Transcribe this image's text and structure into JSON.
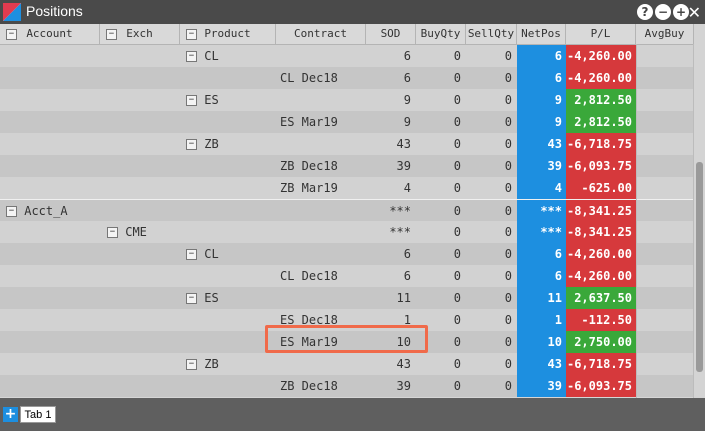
{
  "window": {
    "title": "Positions"
  },
  "columns": {
    "account": "Account",
    "exch": "Exch",
    "product": "Product",
    "contract": "Contract",
    "sod": "SOD",
    "buyqty": "BuyQty",
    "sellqty": "SellQty",
    "netpos": "NetPos",
    "pl": "P/L",
    "avgbuy": "AvgBuy"
  },
  "rows": [
    {
      "product": "CL",
      "contract": "",
      "sod": "6",
      "buy": "0",
      "sell": "0",
      "net": "6",
      "pl": "-4,260.00",
      "pl_sign": "neg"
    },
    {
      "product": "",
      "contract": "CL Dec18",
      "sod": "6",
      "buy": "0",
      "sell": "0",
      "net": "6",
      "pl": "-4,260.00",
      "pl_sign": "neg"
    },
    {
      "product": "ES",
      "contract": "",
      "sod": "9",
      "buy": "0",
      "sell": "0",
      "net": "9",
      "pl": "2,812.50",
      "pl_sign": "pos"
    },
    {
      "product": "",
      "contract": "ES Mar19",
      "sod": "9",
      "buy": "0",
      "sell": "0",
      "net": "9",
      "pl": "2,812.50",
      "pl_sign": "pos"
    },
    {
      "product": "ZB",
      "contract": "",
      "sod": "43",
      "buy": "0",
      "sell": "0",
      "net": "43",
      "pl": "-6,718.75",
      "pl_sign": "neg"
    },
    {
      "product": "",
      "contract": "ZB Dec18",
      "sod": "39",
      "buy": "0",
      "sell": "0",
      "net": "39",
      "pl": "-6,093.75",
      "pl_sign": "neg"
    },
    {
      "product": "",
      "contract": "ZB Mar19",
      "sod": "4",
      "buy": "0",
      "sell": "0",
      "net": "4",
      "pl": "-625.00",
      "pl_sign": "neg"
    },
    {
      "account": "Acct_A",
      "sod": "***",
      "buy": "0",
      "sell": "0",
      "net": "***",
      "pl": "-8,341.25",
      "pl_sign": "neg"
    },
    {
      "exch": "CME",
      "sod": "***",
      "buy": "0",
      "sell": "0",
      "net": "***",
      "pl": "-8,341.25",
      "pl_sign": "neg"
    },
    {
      "product": "CL",
      "contract": "",
      "sod": "6",
      "buy": "0",
      "sell": "0",
      "net": "6",
      "pl": "-4,260.00",
      "pl_sign": "neg"
    },
    {
      "product": "",
      "contract": "CL Dec18",
      "sod": "6",
      "buy": "0",
      "sell": "0",
      "net": "6",
      "pl": "-4,260.00",
      "pl_sign": "neg"
    },
    {
      "product": "ES",
      "contract": "",
      "sod": "11",
      "buy": "0",
      "sell": "0",
      "net": "11",
      "pl": "2,637.50",
      "pl_sign": "pos"
    },
    {
      "product": "",
      "contract": "ES Dec18",
      "sod": "1",
      "buy": "0",
      "sell": "0",
      "net": "1",
      "pl": "-112.50",
      "pl_sign": "neg"
    },
    {
      "product": "",
      "contract": "ES Mar19",
      "sod": "10",
      "buy": "0",
      "sell": "0",
      "net": "10",
      "pl": "2,750.00",
      "pl_sign": "pos"
    },
    {
      "product": "ZB",
      "contract": "",
      "sod": "43",
      "buy": "0",
      "sell": "0",
      "net": "43",
      "pl": "-6,718.75",
      "pl_sign": "neg"
    },
    {
      "product": "",
      "contract": "ZB Dec18",
      "sod": "39",
      "buy": "0",
      "sell": "0",
      "net": "39",
      "pl": "-6,093.75",
      "pl_sign": "neg"
    }
  ],
  "tabs": {
    "add_label": "+",
    "tab1_label": "Tab 1"
  },
  "icons": {
    "collapse": "minus-box-icon",
    "help": "help-icon",
    "minimize": "minimize-icon",
    "maximize": "maximize-icon",
    "close": "close-icon"
  },
  "colors": {
    "netpos": "#1d8fe0",
    "pl_negative": "#d6393c",
    "pl_positive": "#3aa83a",
    "highlight": "#f06a4a"
  }
}
